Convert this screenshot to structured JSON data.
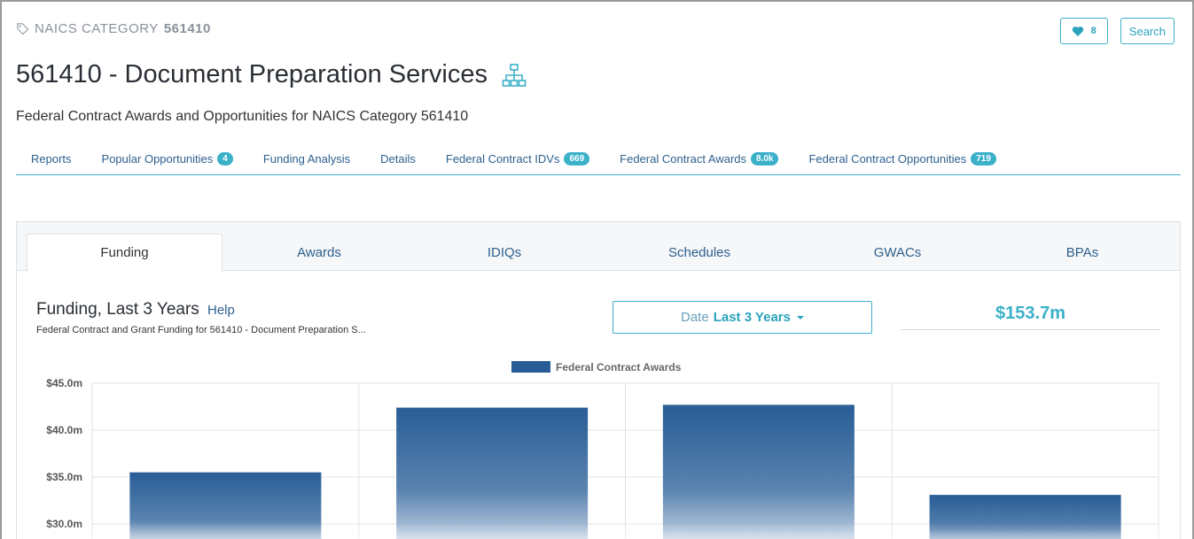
{
  "header": {
    "category_label": "NAICS CATEGORY",
    "category_code": "561410",
    "title": "561410 - Document Preparation Services",
    "subtitle": "Federal Contract Awards and Opportunities for NAICS Category 561410",
    "favorite_count": "8",
    "search_label": "Search"
  },
  "nav": {
    "items": [
      {
        "label": "Reports",
        "badge": ""
      },
      {
        "label": "Popular Opportunities",
        "badge": "4"
      },
      {
        "label": "Funding Analysis",
        "badge": ""
      },
      {
        "label": "Details",
        "badge": ""
      },
      {
        "label": "Federal Contract IDVs",
        "badge": "669"
      },
      {
        "label": "Federal Contract Awards",
        "badge": "8.0k"
      },
      {
        "label": "Federal Contract Opportunities",
        "badge": "719"
      }
    ]
  },
  "tabs": [
    "Funding",
    "Awards",
    "IDIQs",
    "Schedules",
    "GWACs",
    "BPAs"
  ],
  "funding": {
    "title": "Funding, Last 3 Years",
    "help": "Help",
    "subtitle": "Federal Contract and Grant Funding for 561410 - Document Preparation S...",
    "date_label": "Date",
    "date_value": "Last 3 Years",
    "total": "$153.7m"
  },
  "icons": {
    "category": "tag-icon",
    "title_action": "hierarchy-icon",
    "favorite": "heart-icon"
  },
  "colors": {
    "accent": "#3bb0c9",
    "link": "#2c5f8e",
    "bar": "#285d96"
  },
  "chart_data": {
    "type": "bar",
    "legend": [
      "Federal Contract Awards"
    ],
    "legend_position": "top-center",
    "grid": true,
    "y_ticks": [
      "$45.0m",
      "$40.0m",
      "$35.0m",
      "$30.0m"
    ],
    "ylim": [
      28.5,
      45.0
    ],
    "series": [
      {
        "name": "Federal Contract Awards",
        "values": [
          35.5,
          42.4,
          42.7,
          33.1
        ]
      }
    ]
  }
}
